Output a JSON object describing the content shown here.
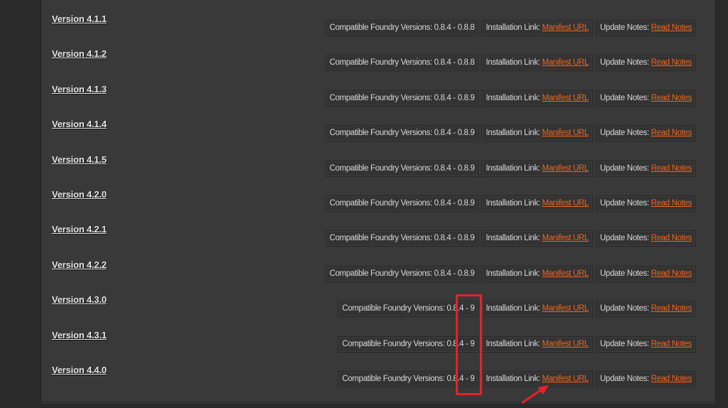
{
  "versions": [
    {
      "label": "Version 4.1.1",
      "compat": "Compatible Foundry Versions: 0.8.4 - 0.8.8"
    },
    {
      "label": "Version 4.1.2",
      "compat": "Compatible Foundry Versions: 0.8.4 - 0.8.8"
    },
    {
      "label": "Version 4.1.3",
      "compat": "Compatible Foundry Versions: 0.8.4 - 0.8.9"
    },
    {
      "label": "Version 4.1.4",
      "compat": "Compatible Foundry Versions: 0.8.4 - 0.8.9"
    },
    {
      "label": "Version 4.1.5",
      "compat": "Compatible Foundry Versions: 0.8.4 - 0.8.9"
    },
    {
      "label": "Version 4.2.0",
      "compat": "Compatible Foundry Versions: 0.8.4 - 0.8.9"
    },
    {
      "label": "Version 4.2.1",
      "compat": "Compatible Foundry Versions: 0.8.4 - 0.8.9"
    },
    {
      "label": "Version 4.2.2",
      "compat": "Compatible Foundry Versions: 0.8.4 - 0.8.9"
    },
    {
      "label": "Version 4.3.0",
      "compat": "Compatible Foundry Versions: 0.8.4 - 9"
    },
    {
      "label": "Version 4.3.1",
      "compat": "Compatible Foundry Versions: 0.8.4 - 9"
    },
    {
      "label": "Version 4.4.0",
      "compat": "Compatible Foundry Versions: 0.8.4 - 9"
    }
  ],
  "install_label": "Installation Link:",
  "manifest_link": "Manifest URL",
  "notes_label": "Update Notes:",
  "notes_link": "Read Notes",
  "colors": {
    "link": "#f0661e",
    "annotation": "#e3222b"
  }
}
